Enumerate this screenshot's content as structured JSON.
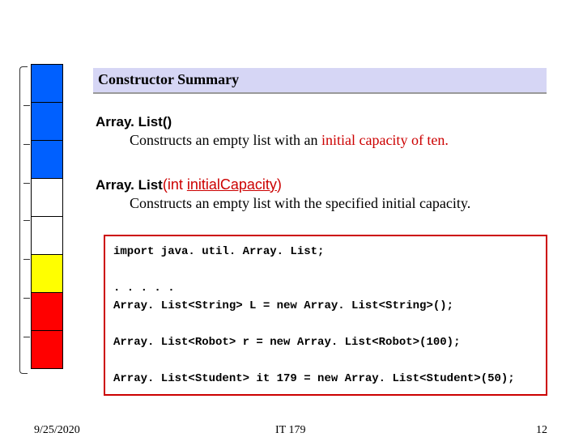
{
  "header": {
    "title": "Constructor Summary"
  },
  "constructors": [
    {
      "name": "Array. List",
      "params_open": "(",
      "params_close": ")",
      "param_keyword": "",
      "param_name": "",
      "desc_prefix": "Constructs an empty list with an ",
      "desc_highlight": "initial capacity of ten.",
      "desc_suffix": ""
    },
    {
      "name": "Array. List",
      "params_open": "(",
      "param_keyword": "int ",
      "param_name": "initialCapacity",
      "params_close": ")",
      "desc_prefix": "Constructs an empty list with the specified initial capacity.",
      "desc_highlight": "",
      "desc_suffix": ""
    }
  ],
  "code": {
    "line1": "import java. util. Array. List;",
    "line2": ". . . . .",
    "line3": "Array. List<String> L = new Array. List<String>();",
    "line4": "Array. List<Robot> r = new Array. List<Robot>(100);",
    "line5": "Array. List<Student> it 179 = new Array. List<Student>(50);"
  },
  "footer": {
    "date": "9/25/2020",
    "course": "IT 179",
    "page": "12"
  },
  "strip_colors": [
    "blue",
    "blue",
    "blue",
    "white",
    "white",
    "yellow",
    "red",
    "red"
  ]
}
